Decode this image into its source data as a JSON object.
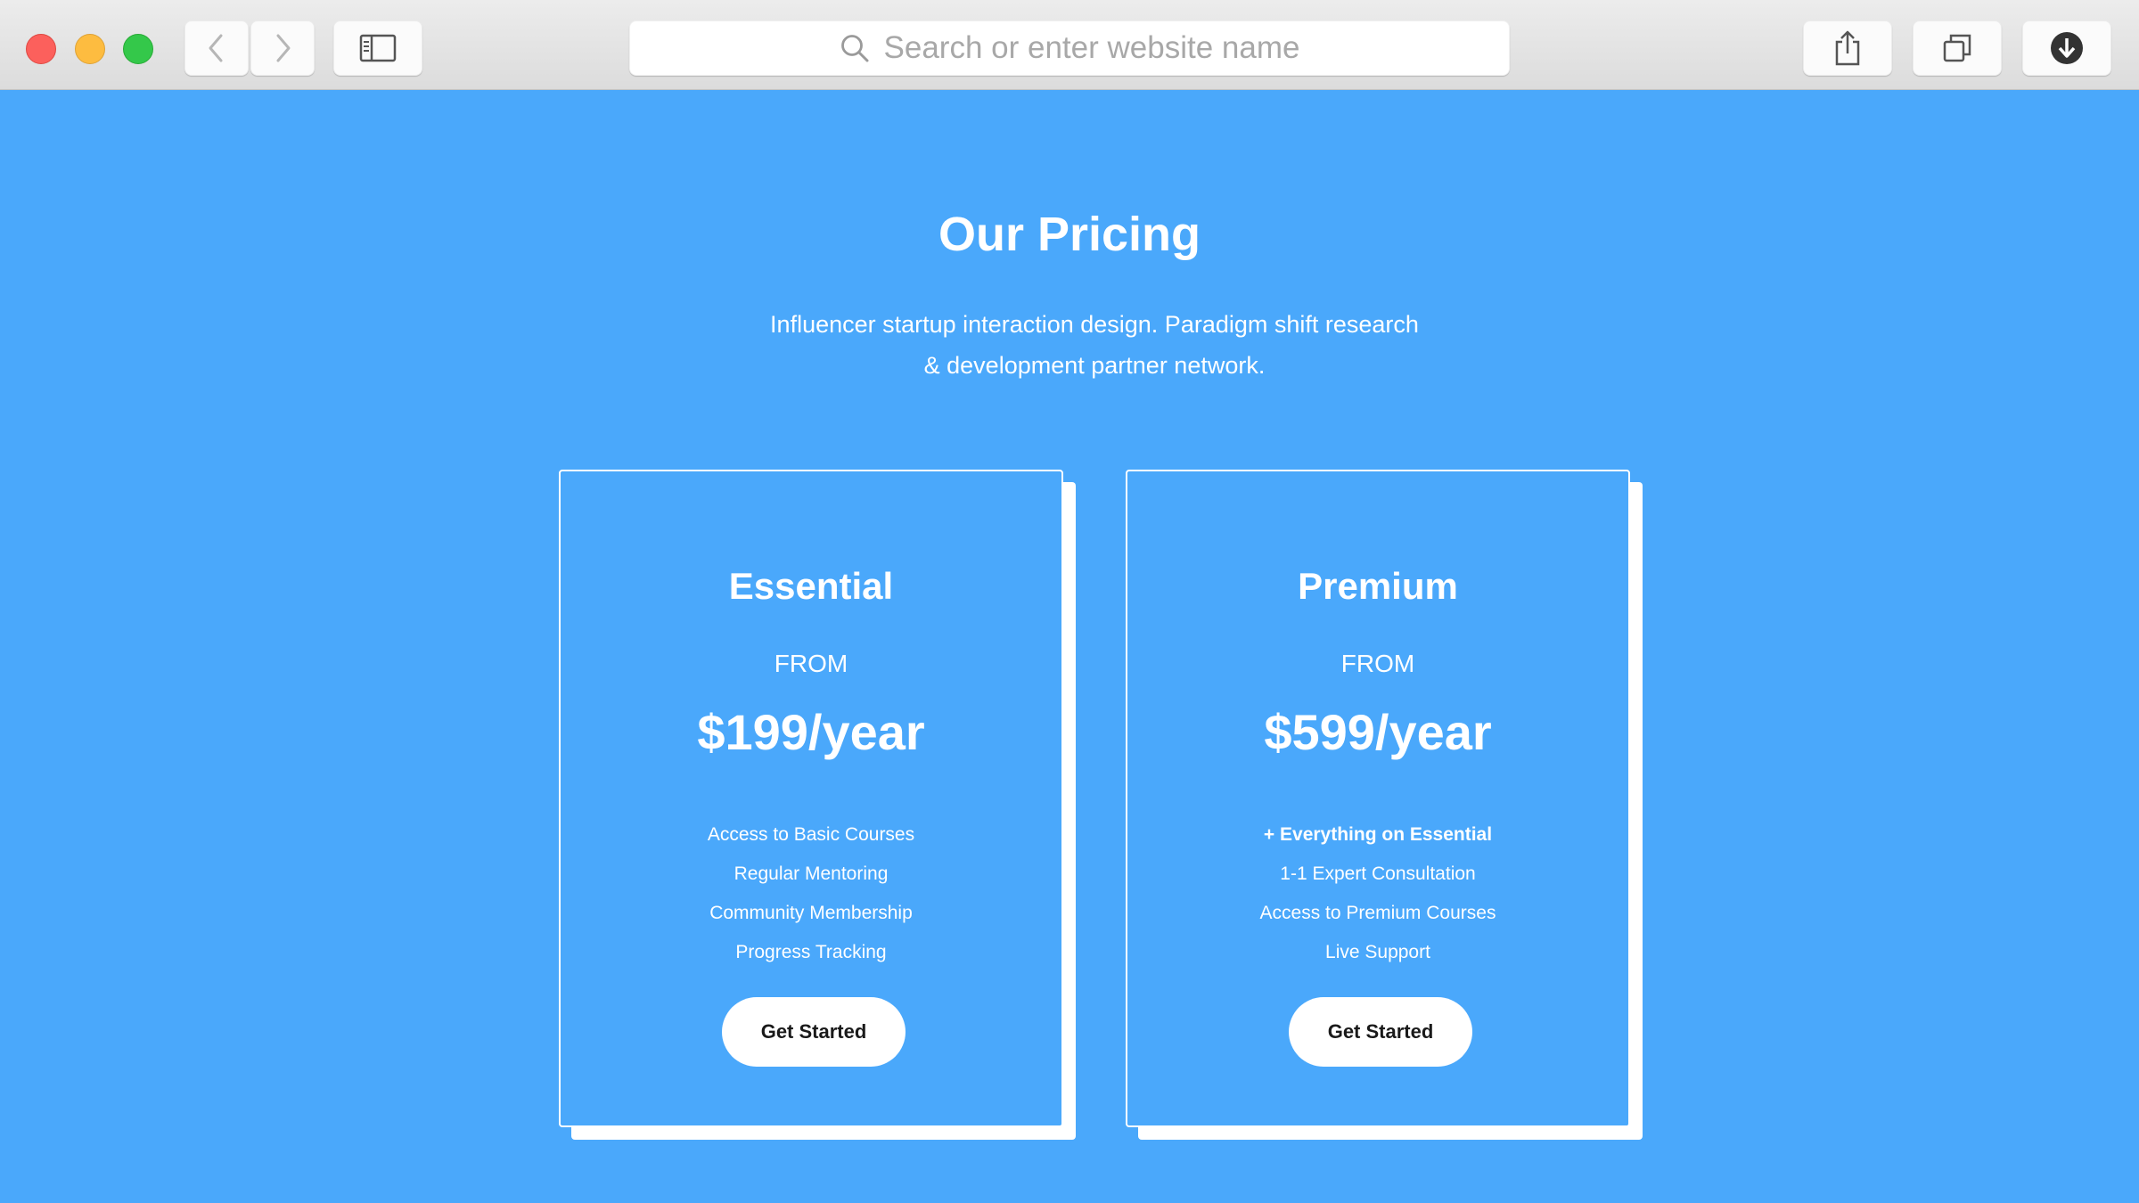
{
  "browser": {
    "address_placeholder": "Search or enter website name",
    "icons": {
      "close": "close-light-icon",
      "minimize": "minimize-light-icon",
      "maximize": "maximize-light-icon",
      "back": "chevron-left-icon",
      "forward": "chevron-right-icon",
      "sidebar": "sidebar-icon",
      "search": "search-icon",
      "share": "share-icon",
      "tabs": "tabs-icon",
      "downloads": "download-icon"
    }
  },
  "colors": {
    "page_background": "#4aa8fb",
    "text": "#ffffff",
    "button_text": "#1a1a1a"
  },
  "page": {
    "title": "Our Pricing",
    "subtitle_line1": "Influencer startup interaction design. Paradigm shift research",
    "subtitle_line2": "& development partner network.",
    "plans": [
      {
        "name": "Essential",
        "from_label": "FROM",
        "price": "$199/year",
        "features": [
          "Access to Basic Courses",
          "Regular Mentoring",
          "Community Membership",
          "Progress Tracking"
        ],
        "cta": "Get Started"
      },
      {
        "name": "Premium",
        "from_label": "FROM",
        "price": "$599/year",
        "features": [
          "+ Everything on Essential",
          "1-1 Expert Consultation",
          "Access to Premium Courses",
          "Live Support"
        ],
        "cta": "Get Started"
      }
    ]
  }
}
